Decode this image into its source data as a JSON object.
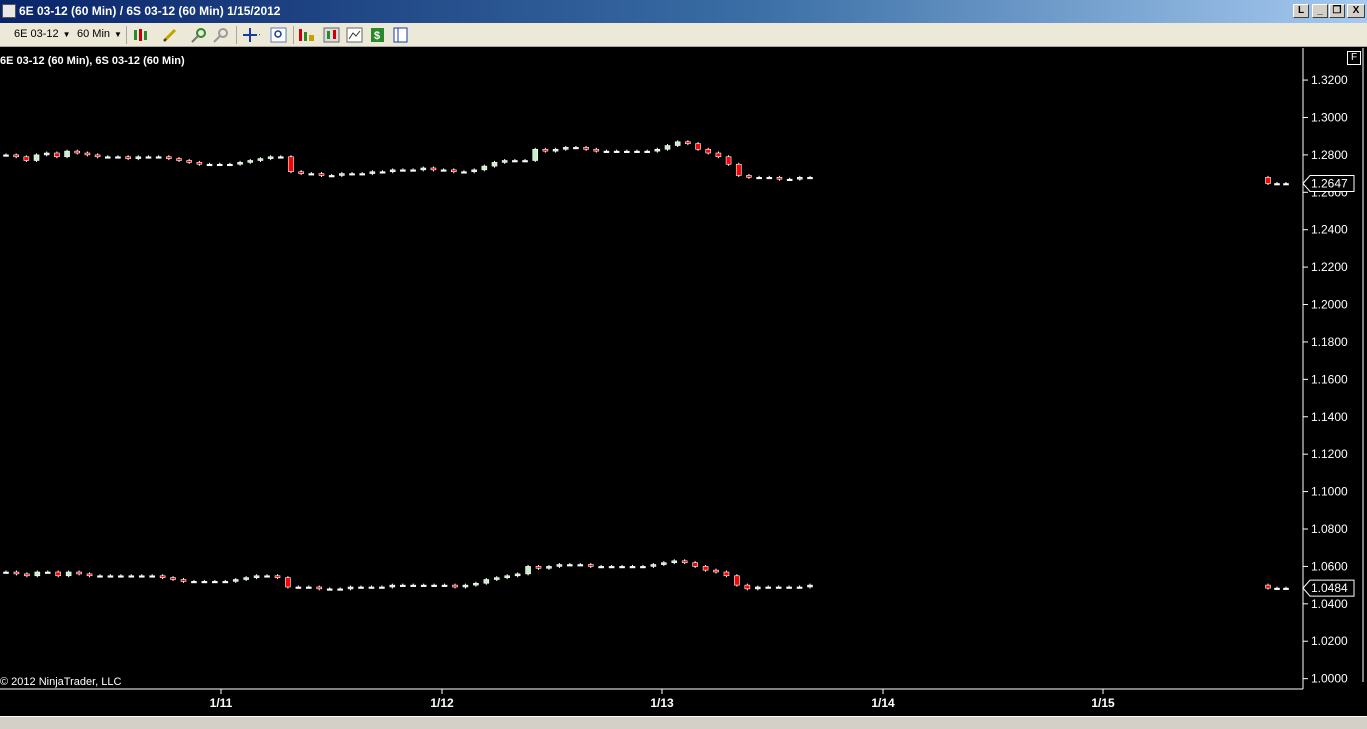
{
  "window": {
    "title": "6E 03-12 (60 Min) / 6S 03-12 (60 Min)  1/15/2012",
    "buttons": {
      "help": "L",
      "minimize": "_",
      "restore": "❐",
      "close": "X"
    }
  },
  "toolbar": {
    "instrument": "6E 03-12",
    "interval": "60 Min",
    "icons": [
      "bar-type-icon",
      "drawing-pencil-icon",
      "zoom-in-icon",
      "zoom-out-icon",
      "crosshair-icon",
      "magnify-icon",
      "indicators-icon",
      "strategies-icon",
      "chart-properties-icon",
      "dollar-icon",
      "data-box-icon"
    ]
  },
  "chart": {
    "legend": "6E 03-12 (60 Min), 6S 03-12 (60 Min)",
    "copyright": "© 2012 NinjaTrader, LLC",
    "f_button": "F",
    "background": "#000000",
    "up_color": "#c8f0c8",
    "down_color": "#ff0000",
    "y_ticks": [
      "1.3200",
      "1.3000",
      "1.2800",
      "1.2600",
      "1.2400",
      "1.2200",
      "1.2000",
      "1.1800",
      "1.1600",
      "1.1400",
      "1.1200",
      "1.1000",
      "1.0800",
      "1.0600",
      "1.0400",
      "1.0200",
      "1.0000"
    ],
    "x_ticks": [
      "1/11",
      "1/12",
      "1/13",
      "1/14",
      "1/15"
    ],
    "last_prices": {
      "6E": "1.2647",
      "6S": "1.0484"
    }
  },
  "chart_data": {
    "type": "candlestick",
    "ylim": [
      0.995,
      1.335
    ],
    "x_ticks": [
      "1/11",
      "1/12",
      "1/13",
      "1/14",
      "1/15"
    ],
    "series": [
      {
        "name": "6E 03-12 (60 Min)",
        "last": 1.2647,
        "closes": [
          1.28,
          1.279,
          1.277,
          1.28,
          1.281,
          1.279,
          1.282,
          1.281,
          1.28,
          1.279,
          1.279,
          1.279,
          1.278,
          1.279,
          1.279,
          1.279,
          1.278,
          1.277,
          1.276,
          1.275,
          1.275,
          1.275,
          1.275,
          1.276,
          1.277,
          1.278,
          1.279,
          1.279,
          1.271,
          1.27,
          1.27,
          1.269,
          1.269,
          1.27,
          1.27,
          1.27,
          1.271,
          1.271,
          1.272,
          1.272,
          1.272,
          1.273,
          1.272,
          1.272,
          1.271,
          1.271,
          1.272,
          1.274,
          1.276,
          1.277,
          1.277,
          1.277,
          1.283,
          1.282,
          1.283,
          1.284,
          1.284,
          1.283,
          1.282,
          1.282,
          1.282,
          1.282,
          1.282,
          1.282,
          1.283,
          1.285,
          1.287,
          1.286,
          1.283,
          1.281,
          1.279,
          1.275,
          1.269,
          1.268,
          1.268,
          1.268,
          1.267,
          1.267,
          1.268,
          1.268,
          1.2647,
          1.2647,
          1.2647
        ]
      },
      {
        "name": "6S 03-12 (60 Min)",
        "last": 1.0484,
        "closes": [
          1.057,
          1.056,
          1.055,
          1.057,
          1.057,
          1.055,
          1.057,
          1.056,
          1.055,
          1.055,
          1.055,
          1.055,
          1.055,
          1.055,
          1.055,
          1.054,
          1.053,
          1.052,
          1.052,
          1.052,
          1.052,
          1.052,
          1.053,
          1.054,
          1.055,
          1.055,
          1.054,
          1.049,
          1.049,
          1.049,
          1.048,
          1.048,
          1.048,
          1.049,
          1.049,
          1.049,
          1.049,
          1.05,
          1.05,
          1.05,
          1.05,
          1.05,
          1.05,
          1.049,
          1.05,
          1.051,
          1.053,
          1.054,
          1.055,
          1.056,
          1.06,
          1.059,
          1.06,
          1.061,
          1.061,
          1.061,
          1.06,
          1.06,
          1.06,
          1.06,
          1.06,
          1.06,
          1.061,
          1.062,
          1.063,
          1.062,
          1.06,
          1.058,
          1.057,
          1.055,
          1.05,
          1.048,
          1.049,
          1.049,
          1.049,
          1.049,
          1.049,
          1.05,
          1.0484,
          1.0484,
          1.0484
        ]
      }
    ]
  }
}
